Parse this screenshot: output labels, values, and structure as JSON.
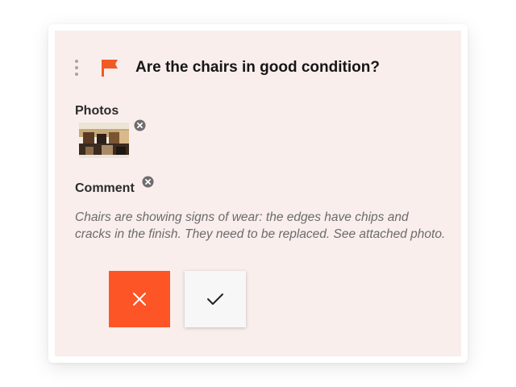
{
  "item": {
    "question": "Are the chairs in good condition?",
    "flag_color": "#f05a24",
    "photos": {
      "label": "Photos",
      "items": [
        {
          "description_icon": "photo-thumbnail"
        }
      ],
      "remove_icon": "remove-circle-icon"
    },
    "comment": {
      "label": "Comment",
      "text": "Chairs are showing signs of wear: the edges have chips and cracks in the finish. They need to be replaced. See attached photo.",
      "remove_icon": "remove-circle-icon"
    },
    "actions": {
      "reject_icon": "close-icon",
      "reject_color": "#fd5526",
      "accept_icon": "check-icon",
      "accept_color": "#f7f7f7"
    }
  },
  "colors": {
    "card_background": "#f9eeec",
    "page_background": "#ffffff"
  }
}
